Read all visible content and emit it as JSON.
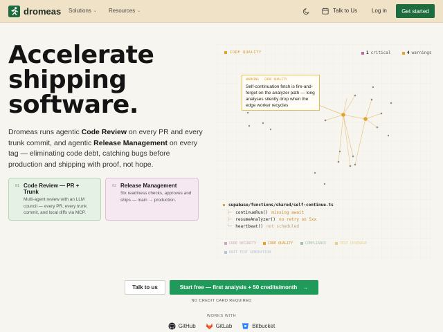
{
  "header": {
    "brand": "dromeas",
    "nav": [
      {
        "label": "Solutions",
        "chevron": "chevron-down-icon"
      },
      {
        "label": "Resources",
        "chevron": "chevron-down-icon"
      }
    ],
    "theme_icon": "moon-icon",
    "talk_label": "Talk to Us",
    "talk_icon": "calendar-icon",
    "login_label": "Log in",
    "cta_label": "Get started"
  },
  "hero": {
    "title_lines": [
      "Accelerate",
      "shipping",
      "software."
    ],
    "desc_parts": [
      "Dromeas runs agentic ",
      "Code Review",
      " on every PR and every trunk commit, and agentic ",
      "Release Management",
      " on every tag — eliminating code debt, catching bugs before production and shipping with proof, not hope."
    ]
  },
  "cards": [
    {
      "num": "01",
      "title": "Code Review — PR + Trunk",
      "body": "Multi-agent review with an LLM council — every PR, every trunk commit, and local diffs via MCP."
    },
    {
      "num": "02",
      "title": "Release Management",
      "body": "Six readiness checks, approves and ships — main → production."
    }
  ],
  "panel": {
    "category": "CODE QUALITY",
    "critical_count": "1",
    "critical_label": "critical",
    "warning_count": "4",
    "warning_label": "warnings",
    "callout": {
      "tags": [
        "WARNING",
        "CODE QUALITY"
      ],
      "text": "Self-continuation fetch is fire-and-forget on the analyzer path — long analyses silently drop when the edge worker recycles"
    },
    "code": {
      "file": "supabase/functions/shared/self-continue.ts",
      "rows": [
        {
          "fn": "continueRun()",
          "status": "missing await"
        },
        {
          "fn": "resumeAnalyzer()",
          "status": "no retry on 5xx"
        },
        {
          "fn": "heartbeat()",
          "status": "not scheduled"
        }
      ]
    },
    "legend": [
      {
        "label": "CODE SECURITY",
        "color": "#c9a7c0",
        "active": false
      },
      {
        "label": "CODE QUALITY",
        "color": "#e0a42e",
        "active": true
      },
      {
        "label": "COMPLIANCE",
        "color": "#9fc4a7",
        "active": false
      },
      {
        "label": "TEST COVERAGE",
        "color": "#e6cf8a",
        "active": false
      },
      {
        "label": "UNIT TEST GENERATION",
        "color": "#b7c6d6",
        "active": false
      }
    ],
    "colors": {
      "warning": "#e0a42e",
      "critical": "#b96aa9"
    }
  },
  "cta": {
    "talk_label": "Talk to us",
    "start_label": "Start free — first analysis + 50 credits/month",
    "start_icon": "arrow-right-icon",
    "no_card": "NO CREDIT CARD REQUIRED",
    "works_with": "WORKS WITH",
    "integrations": [
      {
        "name": "GitHub",
        "icon": "github-icon"
      },
      {
        "name": "GitLab",
        "icon": "gitlab-icon"
      },
      {
        "name": "Bitbucket",
        "icon": "bitbucket-icon"
      }
    ]
  }
}
